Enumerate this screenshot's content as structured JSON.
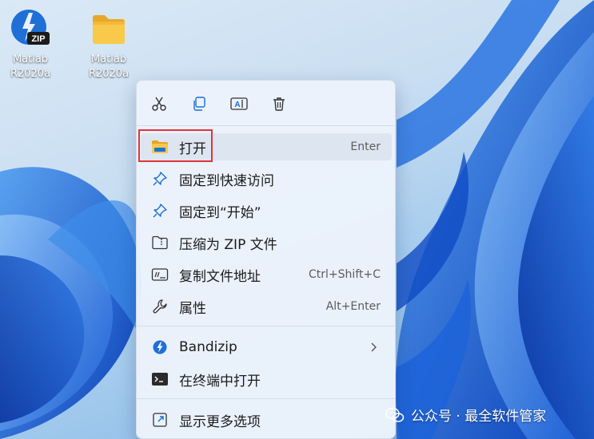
{
  "desktop": {
    "icons": [
      {
        "label": "Matlab\nR2020a",
        "icon": "zip-archive-icon"
      },
      {
        "label": "Matlab\nR2020a",
        "icon": "folder-icon"
      }
    ]
  },
  "context_menu": {
    "toolbar": [
      {
        "icon": "cut-icon"
      },
      {
        "icon": "copy-icon"
      },
      {
        "icon": "rename-icon"
      },
      {
        "icon": "delete-icon"
      }
    ],
    "items": [
      {
        "label": "打开",
        "shortcut": "Enter",
        "icon": "folder-open-icon",
        "highlighted": true
      },
      {
        "label": "固定到快速访问",
        "shortcut": "",
        "icon": "pin-icon"
      },
      {
        "label": "固定到“开始”",
        "shortcut": "",
        "icon": "pin-icon"
      },
      {
        "label": "压缩为 ZIP 文件",
        "shortcut": "",
        "icon": "zip-folder-icon"
      },
      {
        "label": "复制文件地址",
        "shortcut": "Ctrl+Shift+C",
        "icon": "copy-path-icon"
      },
      {
        "label": "属性",
        "shortcut": "Alt+Enter",
        "icon": "wrench-icon"
      },
      {
        "label": "Bandizip",
        "shortcut": "",
        "icon": "bandizip-icon",
        "submenu": true
      },
      {
        "label": "在终端中打开",
        "shortcut": "",
        "icon": "terminal-icon"
      },
      {
        "label": "显示更多选项",
        "shortcut": "",
        "icon": "show-more-icon"
      }
    ]
  },
  "watermark": {
    "text": "公众号 · 最全软件管家"
  },
  "colors": {
    "accent": "#0067c0",
    "highlight_border": "#e0333b",
    "menu_background": "#ecf3fb"
  }
}
